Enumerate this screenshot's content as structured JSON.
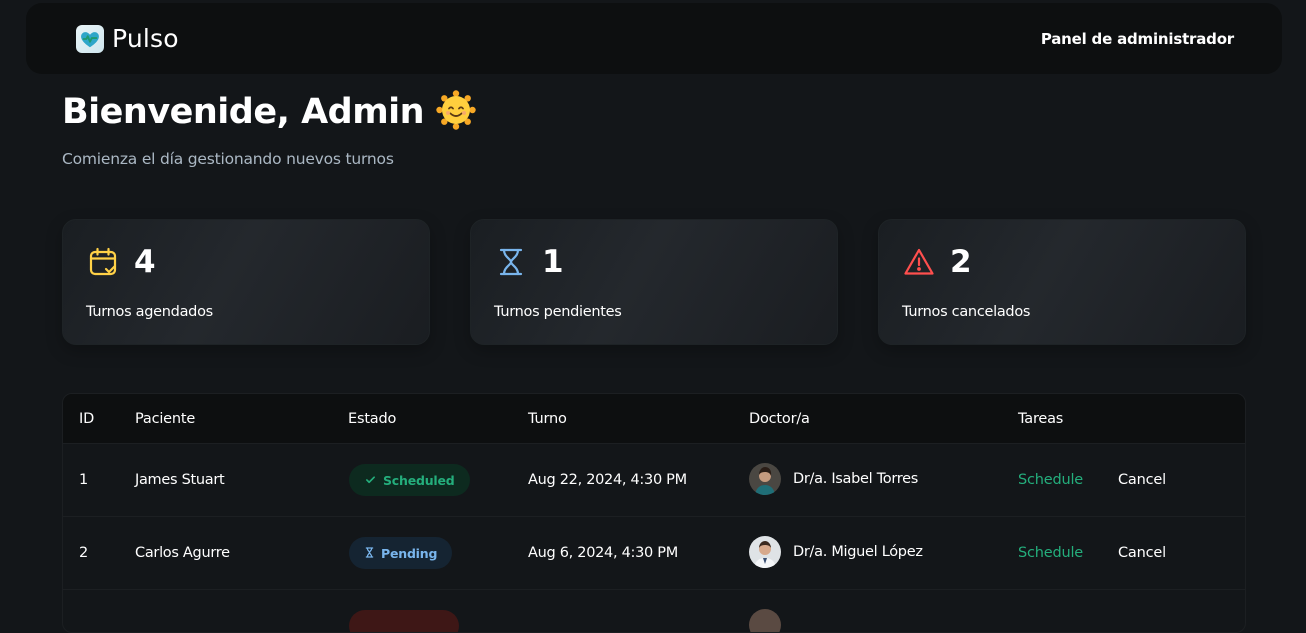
{
  "header": {
    "app_name": "Pulso",
    "admin_link": "Panel de administrador"
  },
  "welcome": {
    "title": "Bienvenide, Admin",
    "emoji": "🌞",
    "subtitle": "Comienza el día gestionando nuevos turnos"
  },
  "stats": [
    {
      "icon": "calendar-check-icon",
      "count": "4",
      "label": "Turnos agendados",
      "color": "#ffd147"
    },
    {
      "icon": "hourglass-icon",
      "count": "1",
      "label": "Turnos pendientes",
      "color": "#79b5ec"
    },
    {
      "icon": "alert-triangle-icon",
      "count": "2",
      "label": "Turnos cancelados",
      "color": "#ff4f4e"
    }
  ],
  "table": {
    "headers": [
      "ID",
      "Paciente",
      "Estado",
      "Turno",
      "Doctor/a",
      "Tareas"
    ],
    "rows": [
      {
        "id": "1",
        "patient": "James Stuart",
        "status": "Scheduled",
        "status_type": "scheduled",
        "date": "Aug 22, 2024, 4:30 PM",
        "doctor": "Dr/a. Isabel Torres",
        "action_schedule": "Schedule",
        "action_cancel": "Cancel"
      },
      {
        "id": "2",
        "patient": "Carlos Agurre",
        "status": "Pending",
        "status_type": "pending",
        "date": "Aug 6, 2024, 4:30 PM",
        "doctor": "Dr/a. Miguel López",
        "action_schedule": "Schedule",
        "action_cancel": "Cancel"
      }
    ]
  },
  "colors": {
    "background": "#131619",
    "panel": "#0d0f10",
    "green": "#24ae7c",
    "blue": "#79b5ec",
    "red": "#ff4f4e",
    "yellow": "#ffd147"
  }
}
